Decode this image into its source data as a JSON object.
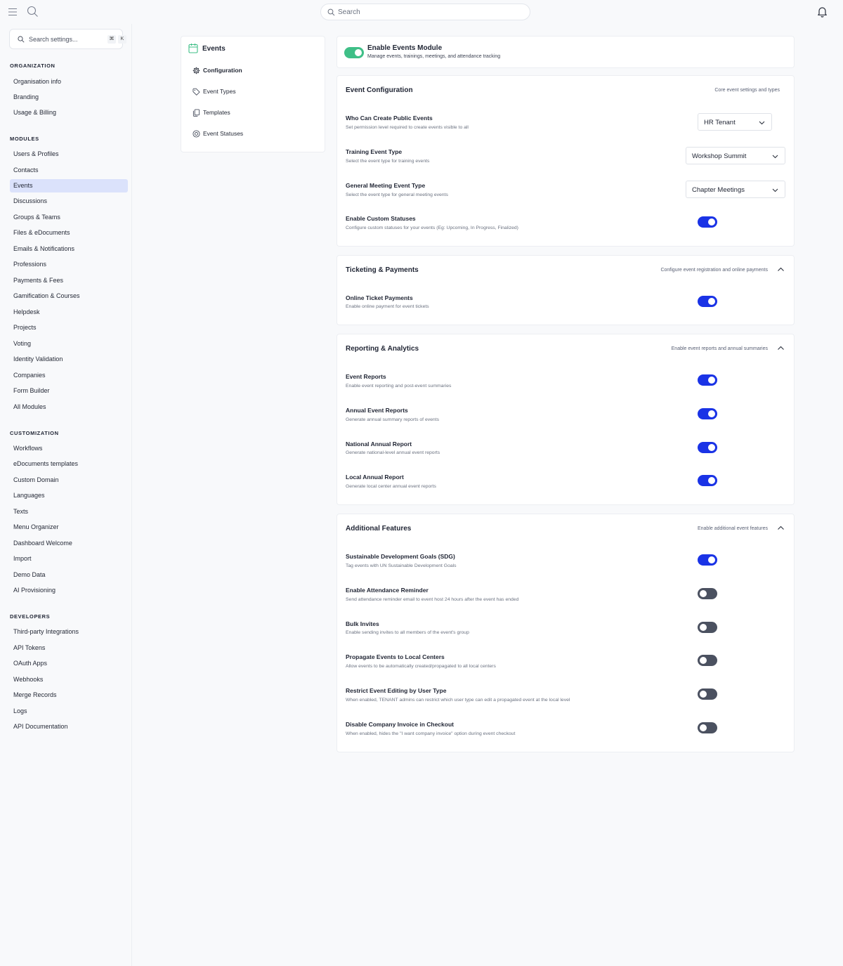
{
  "header": {
    "search_placeholder": "Search"
  },
  "sidebar": {
    "search_placeholder": "Search settings...",
    "shortcut_keys": [
      "⌘",
      "K"
    ],
    "sections": [
      {
        "title": "ORGANIZATION",
        "items": [
          "Organisation info",
          "Branding",
          "Usage & Billing"
        ]
      },
      {
        "title": "MODULES",
        "items": [
          "Users & Profiles",
          "Contacts",
          "Events",
          "Discussions",
          "Groups & Teams",
          "Files & eDocuments",
          "Emails & Notifications",
          "Professions",
          "Payments & Fees",
          "Gamification & Courses",
          "Helpdesk",
          "Projects",
          "Voting",
          "Identity Validation",
          "Companies",
          "Form Builder",
          "All Modules"
        ]
      },
      {
        "title": "CUSTOMIZATION",
        "items": [
          "Workflows",
          "eDocuments templates",
          "Custom Domain",
          "Languages",
          "Texts",
          "Menu Organizer",
          "Dashboard Welcome",
          "Import",
          "Demo Data",
          "AI Provisioning"
        ]
      },
      {
        "title": "DEVELOPERS",
        "items": [
          "Third-party Integrations",
          "API Tokens",
          "OAuth Apps",
          "Webhooks",
          "Merge Records",
          "Logs",
          "API Documentation"
        ]
      }
    ],
    "active_item": "Events"
  },
  "subnav": {
    "title": "Events",
    "items": [
      {
        "label": "Configuration",
        "icon": "gear-icon",
        "active": true
      },
      {
        "label": "Event Types",
        "icon": "tag-icon",
        "active": false
      },
      {
        "label": "Templates",
        "icon": "copy-icon",
        "active": false
      },
      {
        "label": "Event Statuses",
        "icon": "status-icon",
        "active": false
      }
    ]
  },
  "module": {
    "title": "Enable Events Module",
    "description": "Manage events, trainings, meetings, and attendance tracking",
    "enabled": true
  },
  "event_config": {
    "title": "Event Configuration",
    "subtitle": "Core event settings and types",
    "rows": [
      {
        "title": "Who Can Create Public Events",
        "description": "Set permission level required to create events visible to all",
        "select": "HR Tenant"
      },
      {
        "title": "Training Event Type",
        "description": "Select the event type for training events",
        "select": "Workshop Summit"
      },
      {
        "title": "General Meeting Event Type",
        "description": "Select the event type for general meeting events",
        "select": "Chapter Meetings"
      },
      {
        "title": "Enable Custom Statuses",
        "description": "Configure custom statuses for your events (Eg: Upcoming, In Progress, Finalized)",
        "enabled": true
      }
    ]
  },
  "ticketing": {
    "title": "Ticketing & Payments",
    "subtitle": "Configure event registration and online payments",
    "rows": [
      {
        "title": "Online Ticket Payments",
        "description": "Enable online payment for event tickets",
        "enabled": true
      }
    ]
  },
  "reporting": {
    "title": "Reporting & Analytics",
    "subtitle": "Enable event reports and annual summaries",
    "rows": [
      {
        "title": "Event Reports",
        "description": "Enable event reporting and post-event summaries",
        "enabled": true
      },
      {
        "title": "Annual Event Reports",
        "description": "Generate annual summary reports of events",
        "enabled": true
      },
      {
        "title": "National Annual Report",
        "description": "Generate national-level annual event reports",
        "enabled": true
      },
      {
        "title": "Local Annual Report",
        "description": "Generate local center annual event reports",
        "enabled": true
      }
    ]
  },
  "additional": {
    "title": "Additional Features",
    "subtitle": "Enable additional event features",
    "rows": [
      {
        "title": "Sustainable Development Goals (SDG)",
        "description": "Tag events with UN Sustainable Development Goals",
        "enabled": true
      },
      {
        "title": "Enable Attendance Reminder",
        "description": "Send attendance reminder email to event host 24 hours after the event has ended",
        "enabled": false
      },
      {
        "title": "Bulk Invites",
        "description": "Enable sending invites to all members of the event's group",
        "enabled": false
      },
      {
        "title": "Propagate Events to Local Centers",
        "description": "Allow events to be automatically created/propagated to all local centers",
        "enabled": false
      },
      {
        "title": "Restrict Event Editing by User Type",
        "description": "When enabled, TENANT admins can restrict which user type can edit a propagated event at the local level",
        "enabled": false
      },
      {
        "title": "Disable Company Invoice in Checkout",
        "description": "When enabled, hides the \"I want company invoice\" option during event checkout",
        "enabled": false
      }
    ]
  },
  "colors": {
    "accent": "#1a33e6",
    "module_toggle": "#3fbf87",
    "active_nav_bg": "#dbe2fb",
    "toggle_off": "#4b5160"
  }
}
